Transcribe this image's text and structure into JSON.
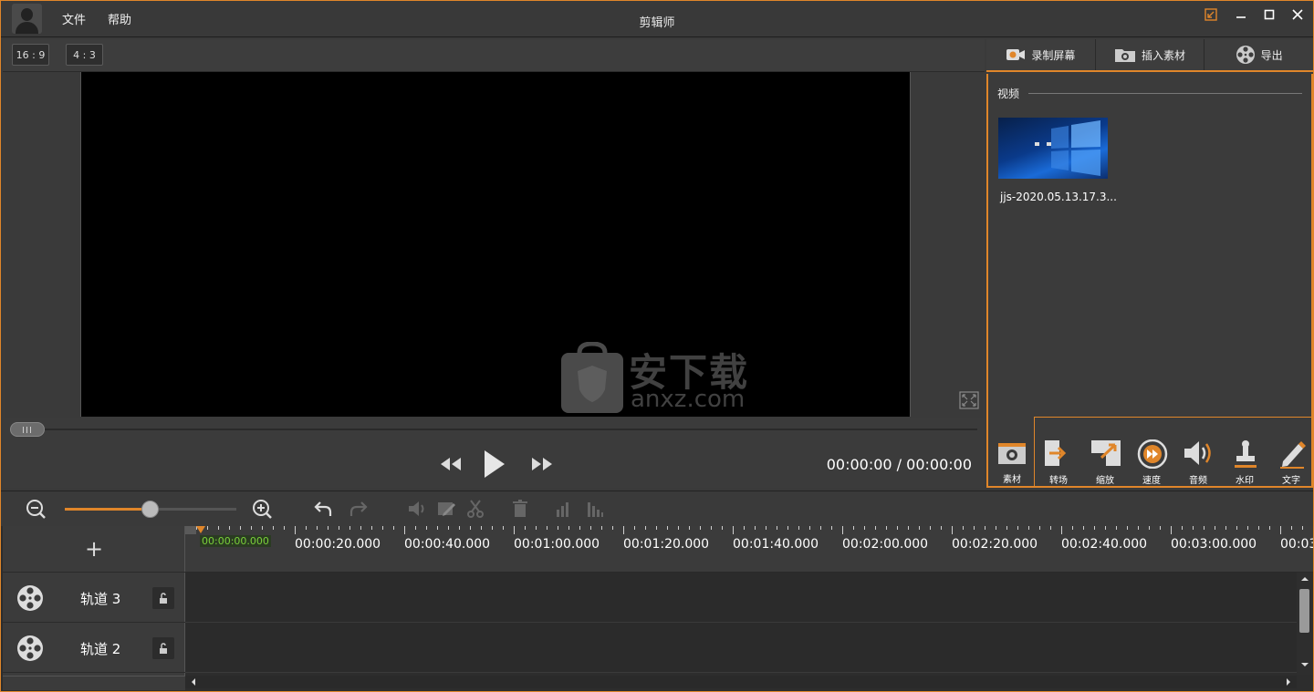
{
  "titlebar": {
    "title": "剪辑师",
    "menus": [
      "文件",
      "帮助"
    ]
  },
  "preview": {
    "ratio_buttons": [
      "16 : 9",
      "4 : 3"
    ],
    "time_readout": "00:00:00 / 00:00:00",
    "watermark_text": "安下载",
    "watermark_url": "anxz.com"
  },
  "right_panel": {
    "tabs": [
      "录制屏幕",
      "插入素材",
      "导出"
    ],
    "section_title": "视频",
    "media_items": [
      {
        "name": "jjs-2020.05.13.17.3..."
      }
    ],
    "tools": [
      "素材",
      "转场",
      "缩放",
      "速度",
      "音频",
      "水印",
      "文字"
    ]
  },
  "timeline": {
    "current_time": "00:00:00.000",
    "ruler_labels": [
      "00:00:20.000",
      "00:00:40.000",
      "00:01:00.000",
      "00:01:20.000",
      "00:01:40.000",
      "00:02:00.000",
      "00:02:20.000",
      "00:02:40.000",
      "00:03:00.000",
      "00:03"
    ],
    "tracks": [
      "轨道 3",
      "轨道 2"
    ],
    "add_track_symbol": "+",
    "zoom_level": 0.5
  },
  "colors": {
    "accent": "#e0862a",
    "time_green": "#7ad03a"
  }
}
